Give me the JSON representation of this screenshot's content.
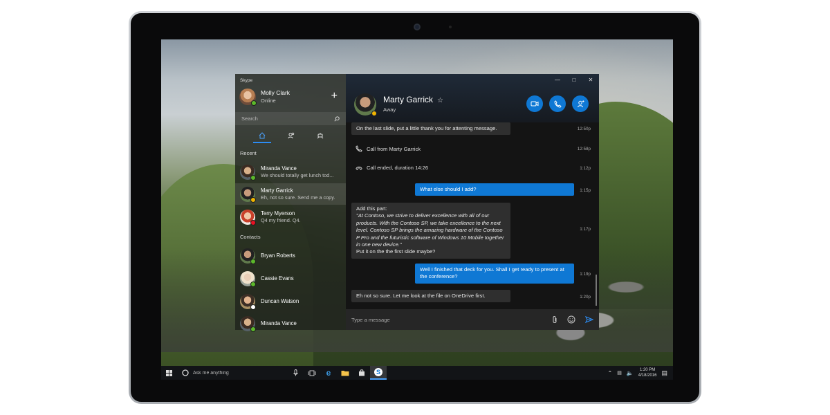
{
  "app": {
    "title": "Skype"
  },
  "profile": {
    "name": "Molly Clark",
    "status": "Online"
  },
  "search": {
    "placeholder": "Search"
  },
  "sections": {
    "recent": "Recent",
    "contacts": "Contacts"
  },
  "recent": [
    {
      "name": "Miranda Vance",
      "preview": "We should totally get lunch tod...",
      "status": "online"
    },
    {
      "name": "Marty Garrick",
      "preview": "Eh, not so sure. Send me a copy.",
      "status": "away"
    },
    {
      "name": "Terry Myerson",
      "preview": "Q4 my friend. Q4.",
      "status": "busy"
    }
  ],
  "contacts": [
    {
      "name": "Bryan Roberts",
      "status": "online"
    },
    {
      "name": "Cassie Evans",
      "status": "online"
    },
    {
      "name": "Duncan Watson",
      "status": "offline"
    },
    {
      "name": "Miranda Vance",
      "status": "online"
    }
  ],
  "conversation": {
    "name": "Marty Garrick",
    "status": "Away"
  },
  "messages": {
    "m1": {
      "text": "On the last slide, put a little thank you for attenting message.",
      "time": "12:50p"
    },
    "m2": {
      "text": "Call from Marty Garrick",
      "time": "12:58p"
    },
    "m3": {
      "text": "Call ended, duration 14:26",
      "time": "1:12p"
    },
    "m4": {
      "text": "What else should I add?",
      "time": "1:15p"
    },
    "m5": {
      "intro": "Add this part:",
      "quote": "\"At Contoso, we strive to deliver excellence with all of our products. With the Contoso SP, we take excellence to the next level. Contoso SP brings the amazing hardware of the Contoso P Pro and the futuristic software of Windows 10 Mobile together in one new device.\"",
      "outro": "Put it on the the first slide maybe?",
      "time": "1:17p"
    },
    "m6": {
      "text": "Well I finished that deck for you. Shall I get ready to present at the conference?",
      "time": "1:19p"
    },
    "m7": {
      "text": "Eh not so sure. Let me look at the file on OneDrive first.",
      "time": "1:20p"
    }
  },
  "compose": {
    "placeholder": "Type a message"
  },
  "taskbar": {
    "search_placeholder": "Ask me anything",
    "time": "1:20 PM",
    "date": "4/18/2016"
  },
  "colors": {
    "accent": "#0f78d4",
    "online": "#5cb82b",
    "away": "#f0b400",
    "busy": "#e81123"
  }
}
